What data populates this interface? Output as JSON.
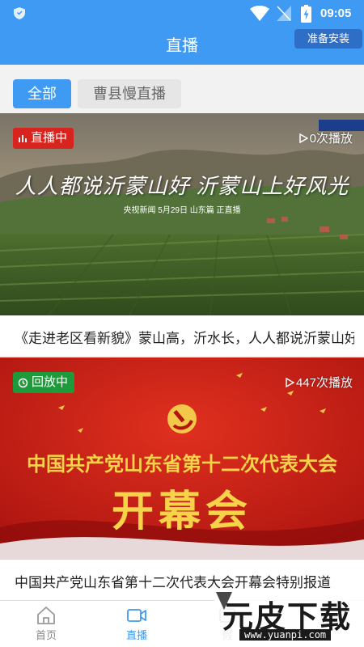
{
  "status_bar": {
    "time": "09:05"
  },
  "header": {
    "title": "直播",
    "install_label": "准备安装"
  },
  "tabs": [
    {
      "label": "全部",
      "active": true
    },
    {
      "label": "曹县慢直播",
      "active": false
    }
  ],
  "cards": [
    {
      "badge": "直播中",
      "badge_type": "live",
      "plays": "0次播放",
      "overlay_main": "人人都说沂蒙山好 沂蒙山上好风光",
      "overlay_sub": "央视新闻 5月29日 山东篇 正直播",
      "title": "《走进老区看新貌》蒙山高，沂水长，人人都说沂蒙山好"
    },
    {
      "badge": "回放中",
      "badge_type": "replay",
      "plays": "447次播放",
      "overlay_line1": "中国共产党山东省第十二次代表大会",
      "overlay_line2": "开幕会",
      "title": "中国共产党山东省第十二次代表大会开幕会特别报道"
    }
  ],
  "bottom_nav": [
    {
      "label": "首页",
      "icon": "home-icon",
      "active": false
    },
    {
      "label": "直播",
      "icon": "video-icon",
      "active": true
    },
    {
      "label": "假",
      "icon": "misc-icon",
      "active": false
    }
  ],
  "watermark": {
    "main": "元皮下载",
    "url": "www.yuanpi.com"
  },
  "colors": {
    "primary": "#3f9af3",
    "live_red": "#d7241f",
    "replay_green": "#1e9a3a"
  }
}
